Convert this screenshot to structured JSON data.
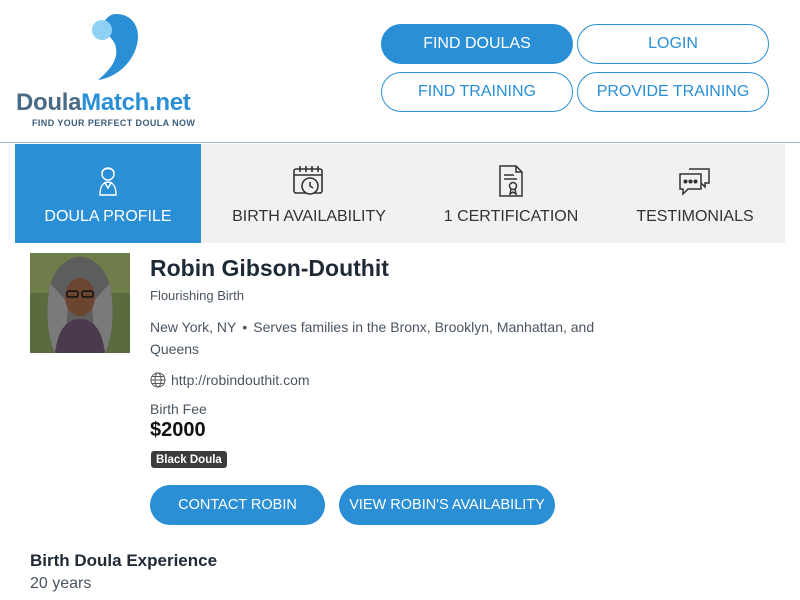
{
  "logo": {
    "name_part1": "Doula",
    "name_part2": "Match.net",
    "tagline": "FIND YOUR PERFECT DOULA NOW",
    "icon": "logo-mark"
  },
  "header": {
    "find_doulas": "FIND DOULAS",
    "login": "LOGIN",
    "find_training": "FIND TRAINING",
    "provide_training": "PROVIDE TRAINING"
  },
  "tabs": [
    {
      "label": "DOULA PROFILE",
      "icon": "doula-person-icon",
      "active": true
    },
    {
      "label": "BIRTH AVAILABILITY",
      "icon": "calendar-clock-icon",
      "active": false
    },
    {
      "label": "1 CERTIFICATION",
      "icon": "certificate-icon",
      "active": false
    },
    {
      "label": "TESTIMONIALS",
      "icon": "chat-bubbles-icon",
      "active": false
    }
  ],
  "profile": {
    "name": "Robin Gibson-Douthit",
    "organization": "Flourishing Birth",
    "location": "New York, NY",
    "serves": "Serves families in the Bronx, Brooklyn, Manhattan, and Queens",
    "website": "http://robindouthit.com",
    "fee_label": "Birth Fee",
    "fee": "$2000",
    "badge": "Black Doula",
    "contact_button": "CONTACT ROBIN",
    "availability_button": "VIEW ROBIN'S AVAILABILITY"
  },
  "experience": {
    "title": "Birth Doula Experience",
    "value": "20 years"
  },
  "colors": {
    "accent": "#2b8fd6",
    "tab_bg": "#f1f1f1",
    "text_muted": "#4a5560",
    "badge_bg": "#3c3c3c"
  }
}
